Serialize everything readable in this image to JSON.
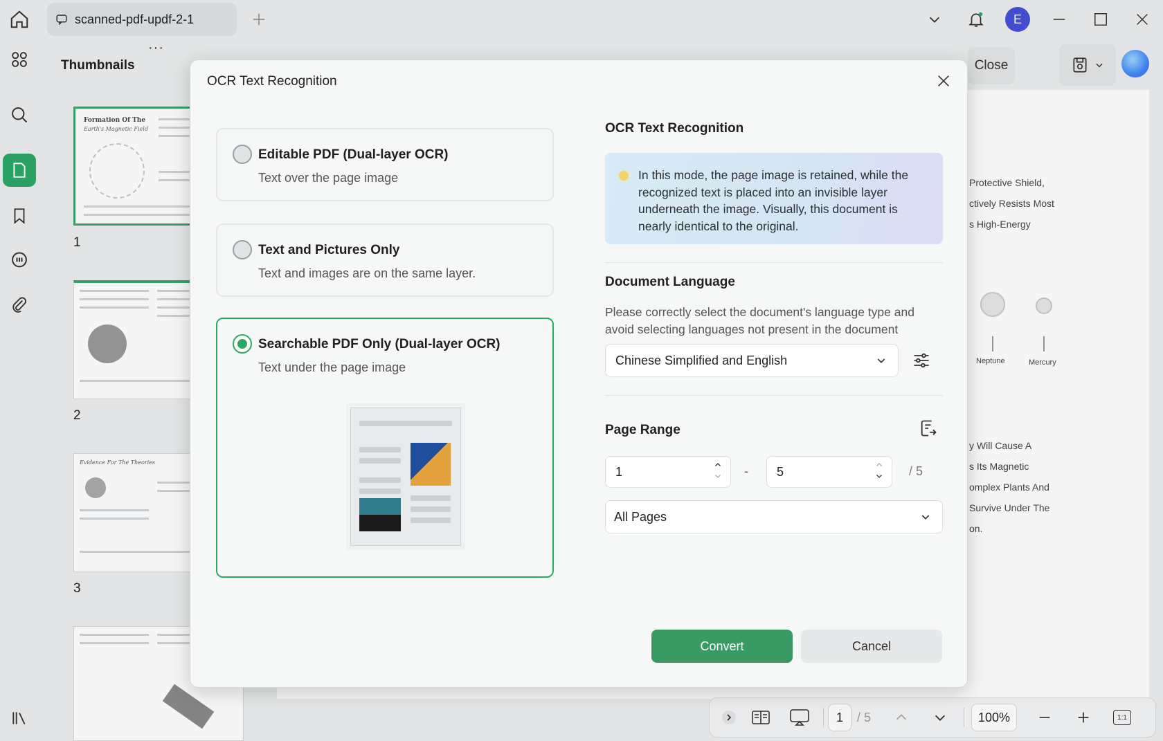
{
  "tab": {
    "title": "scanned-pdf-updf-2-1"
  },
  "window": {
    "avatar_letter": "E"
  },
  "sidebar": {
    "title": "Thumbnails",
    "more": "···",
    "pages": [
      "1",
      "2",
      "3"
    ]
  },
  "thumbs": {
    "t1_title": "Formation Of The",
    "t1_sub": "Earth's Magnetic Field",
    "t3_title": "Evidence For The Theories"
  },
  "toolbar": {
    "close_label": "Close"
  },
  "document": {
    "lines": [
      "Protective Shield,",
      "ctively Resists Most",
      "s High-Energy",
      "y Will Cause A",
      "s Its Magnetic",
      "omplex Plants And",
      "Survive Under The",
      "on."
    ],
    "planet_labels": [
      "Neptune",
      "Mercury"
    ]
  },
  "dialog": {
    "title": "OCR Text Recognition",
    "options": [
      {
        "title": "Editable PDF (Dual-layer OCR)",
        "subtitle": "Text over the page image",
        "selected": false
      },
      {
        "title": "Text and Pictures Only",
        "subtitle": "Text and images are on the same layer.",
        "selected": false
      },
      {
        "title": "Searchable PDF Only (Dual-layer OCR)",
        "subtitle": "Text under the page image",
        "selected": true
      }
    ],
    "ocr_section": {
      "title": "OCR Text Recognition",
      "info": "In this mode, the page image is retained, while the recognized text is placed into an invisible layer underneath the image. Visually, this document is nearly identical to the original."
    },
    "language_section": {
      "title": "Document Language",
      "help": "Please correctly select the document's language type and avoid selecting languages not present in the document",
      "selected": "Chinese Simplified and English"
    },
    "range_section": {
      "title": "Page Range",
      "from": "1",
      "dash": "-",
      "to": "5",
      "total": "/ 5",
      "preset": "All Pages"
    },
    "convert_label": "Convert",
    "cancel_label": "Cancel"
  },
  "bottom": {
    "page": "1",
    "total": "/ 5",
    "zoom": "100%",
    "fit_label": "1:1"
  },
  "colors": {
    "accent": "#2aa866",
    "convert": "#3a9a63",
    "avatar": "#4650d6"
  }
}
